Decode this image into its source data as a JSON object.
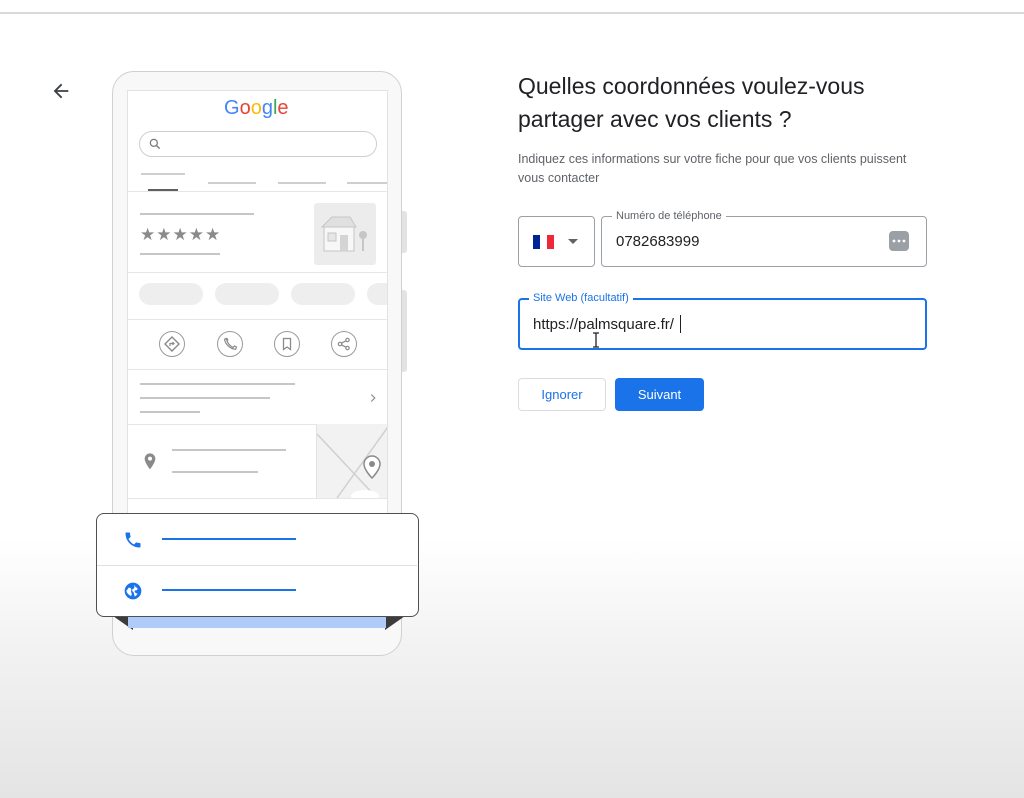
{
  "header": {
    "back_icon": "arrow-left-icon"
  },
  "illustration": {
    "brand": {
      "letters": [
        "G",
        "o",
        "o",
        "g",
        "l",
        "e"
      ],
      "colors": [
        "#4285F4",
        "#EA4335",
        "#FBBC05",
        "#4285F4",
        "#34A853",
        "#EA4335"
      ]
    },
    "rating_stars": "★★★★★",
    "action_icons": [
      "directions-icon",
      "phone-icon",
      "bookmark-icon",
      "share-icon"
    ],
    "popup_icons": [
      "phone-icon",
      "globe-icon"
    ]
  },
  "form": {
    "title": "Quelles coordonnées voulez-vous partager avec vos clients ?",
    "subtitle": "Indiquez ces informations sur votre fiche pour que vos clients puissent vous contacter",
    "country": {
      "flag": "france-flag-icon",
      "flag_colors": [
        "#002395",
        "#FFFFFF",
        "#ED2939"
      ]
    },
    "phone": {
      "label": "Numéro de téléphone",
      "value": "0782683999",
      "icon": "password-dots-icon"
    },
    "website": {
      "label": "Site Web (facultatif)",
      "value": "https://palmsquare.fr/"
    },
    "buttons": {
      "skip": "Ignorer",
      "next": "Suivant"
    }
  },
  "colors": {
    "accent": "#1a73e8",
    "border": "#9aa0a6",
    "secondary_text": "#5f6368"
  }
}
